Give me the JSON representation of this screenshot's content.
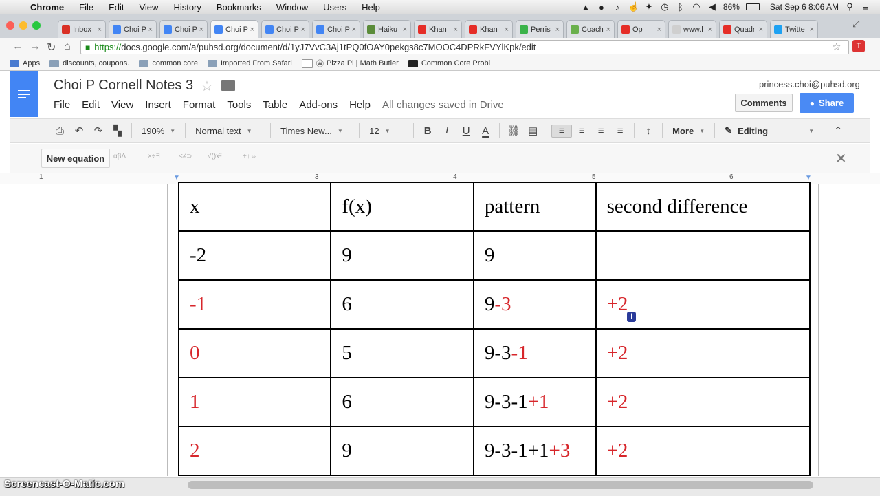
{
  "macbar": {
    "app": "Chrome",
    "menus": [
      "File",
      "Edit",
      "View",
      "History",
      "Bookmarks",
      "Window",
      "Users",
      "Help"
    ],
    "battery": "86%",
    "datetime": "Sat Sep 6  8:06 AM"
  },
  "tabs": [
    {
      "label": "Inbox",
      "color": "#d93025"
    },
    {
      "label": "Choi P",
      "color": "#4285f4"
    },
    {
      "label": "Choi P",
      "color": "#4285f4"
    },
    {
      "label": "Choi P",
      "color": "#4285f4",
      "active": true
    },
    {
      "label": "Choi P",
      "color": "#4285f4"
    },
    {
      "label": "Choi P",
      "color": "#4285f4"
    },
    {
      "label": "Haiku",
      "color": "#5b8c3a"
    },
    {
      "label": "Khan",
      "color": "#e52d27"
    },
    {
      "label": "Khan",
      "color": "#e52d27"
    },
    {
      "label": "Perris",
      "color": "#3bb34a"
    },
    {
      "label": "Coach",
      "color": "#6ab04c"
    },
    {
      "label": "Op",
      "color": "#e52d27"
    },
    {
      "label": "www.l",
      "color": "#cfcfcf"
    },
    {
      "label": "Quadr",
      "color": "#e52d27"
    },
    {
      "label": "Twitte",
      "color": "#1da1f2"
    }
  ],
  "address": {
    "scheme": "https://",
    "url": "docs.google.com/a/puhsd.org/document/d/1yJ7VvC3Aj1tPQ0fOAY0pekgs8c7MOOC4DPRkFVYlKpk/edit"
  },
  "bookmarks": [
    "Apps",
    "discounts, coupons.",
    "common core",
    "Imported From Safari",
    "Pizza Pi | Math Butler",
    "Common Core Probl"
  ],
  "doc": {
    "title": "Choi P Cornell Notes 3",
    "menus": [
      "File",
      "Edit",
      "View",
      "Insert",
      "Format",
      "Tools",
      "Table",
      "Add-ons",
      "Help"
    ],
    "saved": "All changes saved in Drive",
    "email": "princess.choi@puhsd.org",
    "comments": "Comments",
    "share": "Share"
  },
  "toolbar": {
    "zoom": "190%",
    "style": "Normal text",
    "font": "Times New...",
    "size": "12",
    "more": "More",
    "mode": "Editing"
  },
  "equation": {
    "button": "New equation",
    "groups": [
      "αβΔ",
      "×÷∃",
      "≤≠⊃",
      "√()x²",
      "+↑⇔"
    ]
  },
  "ruler": [
    "1",
    "3",
    "4",
    "5",
    "6"
  ],
  "table": {
    "headers": [
      "x",
      "f(x)",
      "pattern",
      "second difference"
    ],
    "rows": [
      {
        "x": "-2",
        "x_red": false,
        "fx": "9",
        "pattern": "9",
        "pattern_red": "",
        "second": ""
      },
      {
        "x": "-1",
        "x_red": true,
        "fx": "6",
        "pattern": "9",
        "pattern_red": "-3",
        "second": "+2"
      },
      {
        "x": "0",
        "x_red": true,
        "fx": "5",
        "pattern": "9-3",
        "pattern_red": "-1",
        "second": "+2"
      },
      {
        "x": "1",
        "x_red": true,
        "fx": "6",
        "pattern": "9-3-1",
        "pattern_red": "+1",
        "second": "+2"
      },
      {
        "x": "2",
        "x_red": true,
        "fx": "9",
        "pattern": "9-3-1+1",
        "pattern_red": "+3",
        "second": "+2"
      }
    ],
    "accent_color": "#d7262b"
  },
  "watermark": "Screencast-O-Matic.com"
}
